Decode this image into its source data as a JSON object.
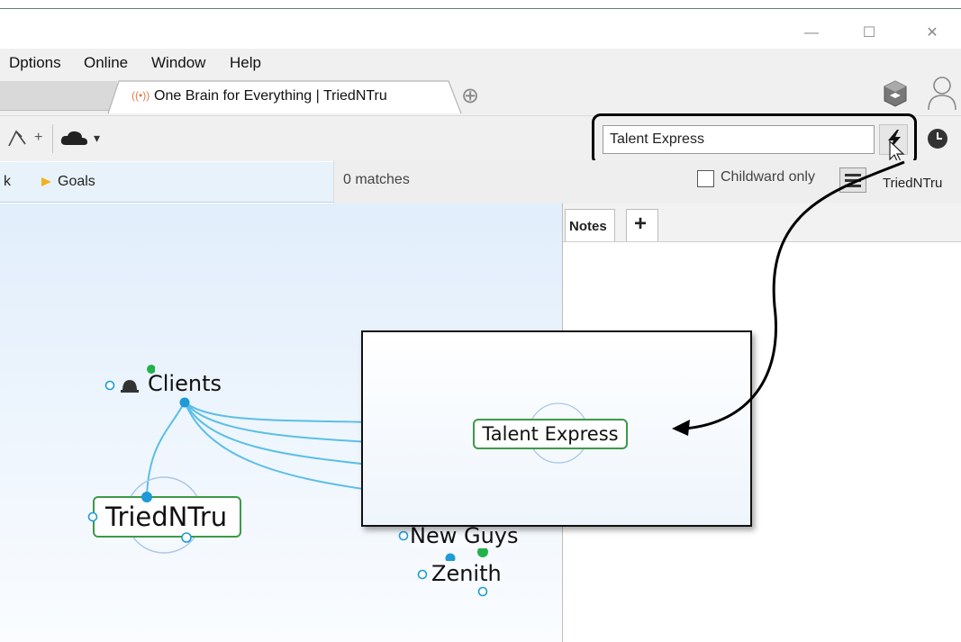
{
  "window": {
    "minimize_glyph": "—",
    "maximize_glyph": "☐",
    "close_glyph": "✕"
  },
  "menu": {
    "items": [
      "Options",
      "Online",
      "Window",
      "Help"
    ],
    "first_visible": "Dptions"
  },
  "tabs": {
    "active_label": "One Brain for Everything | TriedNTru",
    "active_icon": "broadcast-icon",
    "add_glyph": "⊕"
  },
  "toolbar": {
    "plus_glyph": "+",
    "dropdown_glyph": "▾"
  },
  "search": {
    "value": "Talent Express",
    "results_text": "0 matches",
    "childward_label": "Childward only"
  },
  "breadcrumb": {
    "partial": "k",
    "goals_label": "Goals"
  },
  "right_header_text": "TriedNTru",
  "notes": {
    "tab_label": "Notes",
    "add_tab_glyph": "+"
  },
  "plex": {
    "clients": "Clients",
    "active_thought": "TriedNTru",
    "new_guys": "New Guys",
    "zenith": "Zenith"
  },
  "zoom": {
    "thought": "Talent Express"
  },
  "colors": {
    "link": "#5bbfe6",
    "node_dot": "#1e9ad6",
    "green_dot": "#21b24a",
    "box_border": "#3c9a48",
    "goal_flag": "#f2b21b"
  }
}
